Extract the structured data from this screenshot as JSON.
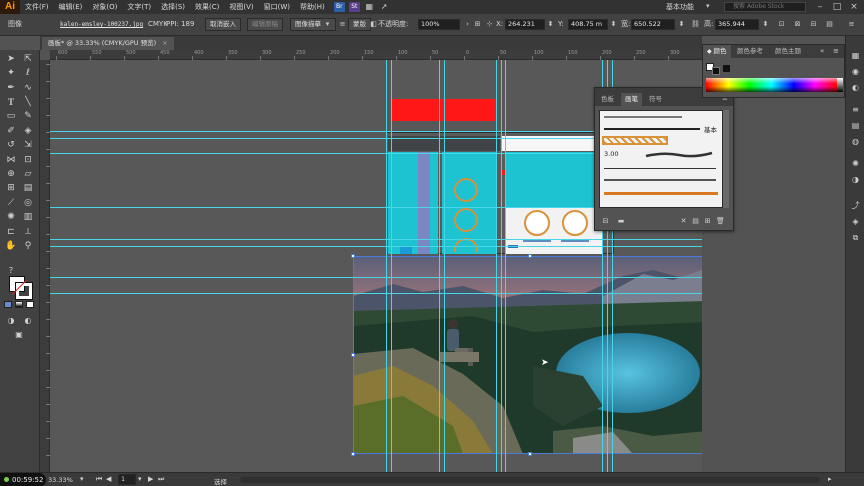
{
  "app": {
    "logo": "Ai"
  },
  "menu": {
    "items": [
      "文件(F)",
      "编辑(E)",
      "对象(O)",
      "文字(T)",
      "选择(S)",
      "效果(C)",
      "视图(V)",
      "窗口(W)",
      "帮助(H)"
    ]
  },
  "menu_icons": {
    "br": "Br",
    "st": "St"
  },
  "workspace": {
    "label": "基本功能",
    "stock_placeholder": "搜索 Adobe Stock"
  },
  "controlbar": {
    "object_type": "图像",
    "filename": "kalen-emsley-100237.jpg",
    "color_mode": "CMYK",
    "ppi": "PPI: 189",
    "embed_button": "取消嵌入",
    "edit_original_button": "编辑原稿",
    "image_trace_button": "图像描摹",
    "mask_button": "蒙版",
    "opacity_label": "不透明度:",
    "opacity_value": "100%",
    "x_label": "X:",
    "x_value": "264.231",
    "y_label": "Y:",
    "y_value": "408.75 m",
    "w_label": "宽:",
    "w_value": "650.522",
    "h_label": "高:",
    "h_value": "365.944"
  },
  "document_tab": {
    "title": "画板* @ 33.33% (CMYK/GPU 预览)",
    "close": "×"
  },
  "ruler": {
    "h_labels": [
      "600",
      "550",
      "500",
      "450",
      "400",
      "350",
      "300",
      "250",
      "200",
      "150",
      "100",
      "50",
      "0",
      "50",
      "100",
      "150",
      "200",
      "250",
      "300",
      "350"
    ]
  },
  "color_panel": {
    "tabs": [
      "颜色",
      "颜色参考",
      "颜色主题"
    ],
    "active": 0
  },
  "brush_panel": {
    "tabs": [
      "色板",
      "画笔",
      "符号"
    ],
    "active": 1,
    "basic_label": "基本",
    "size_label": "3.00"
  },
  "statusbar": {
    "timer": "00:59:52",
    "zoom": "33.33%",
    "page": "1",
    "tool": "选择"
  },
  "colors": {
    "accent_cyan": "#1ec3d2",
    "guide": "#46d6e6",
    "red_rect": "#ff1616",
    "brush_orange": "#d97a22"
  }
}
